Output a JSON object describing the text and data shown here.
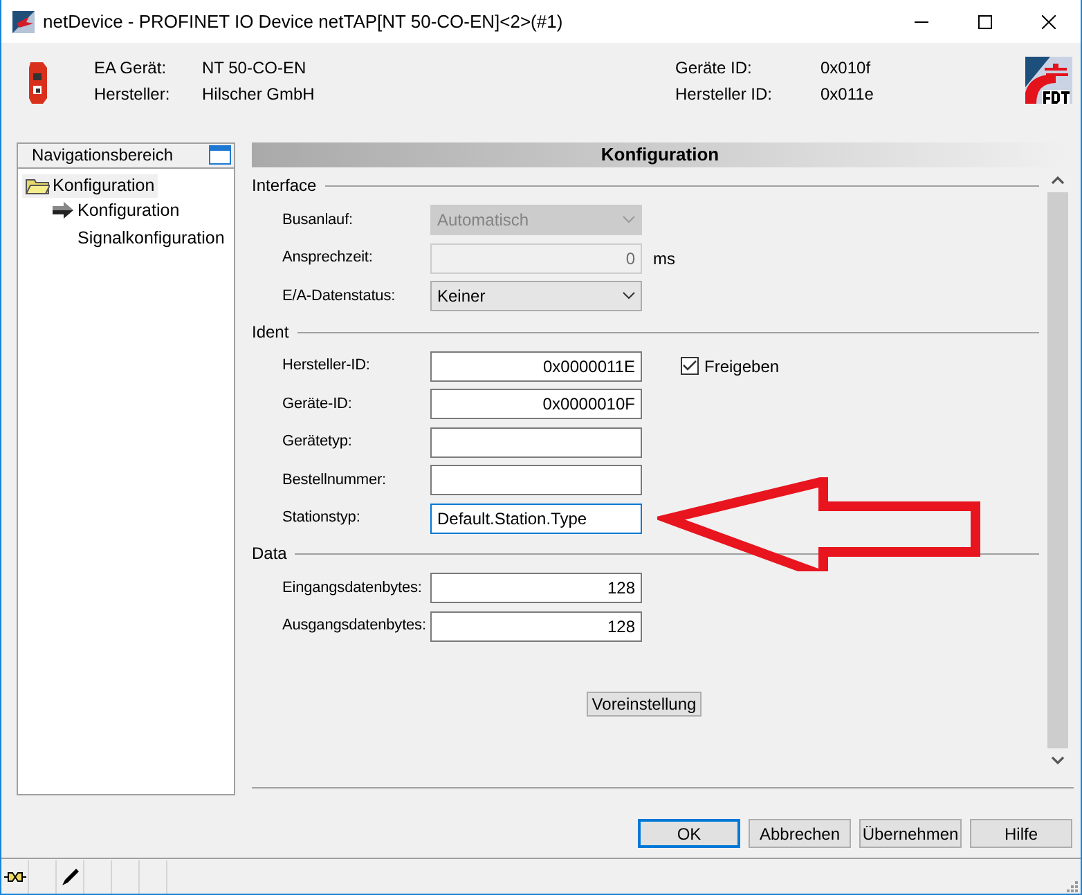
{
  "window": {
    "title": "netDevice - PROFINET IO Device netTAP[NT 50-CO-EN]<2>(#1)"
  },
  "header": {
    "left": [
      {
        "label": "EA Gerät:",
        "value": "NT 50-CO-EN"
      },
      {
        "label": "Hersteller:",
        "value": "Hilscher GmbH"
      }
    ],
    "right": [
      {
        "label": "Geräte ID:",
        "value": "0x010f"
      },
      {
        "label": "Hersteller ID:",
        "value": "0x011e"
      }
    ]
  },
  "navigation": {
    "title": "Navigationsbereich",
    "items": [
      {
        "label": "Konfiguration",
        "selected": true,
        "children": [
          {
            "label": "Konfiguration",
            "selected": false,
            "current": true
          },
          {
            "label": "Signalkonfiguration",
            "selected": false,
            "current": false
          }
        ]
      }
    ]
  },
  "panel": {
    "title": "Konfiguration",
    "sections": [
      {
        "title": "Interface",
        "rows": [
          {
            "label": "Busanlauf:",
            "kind": "select",
            "value": "Automatisch",
            "disabled": true
          },
          {
            "label": "Ansprechzeit:",
            "kind": "input",
            "value": "0",
            "disabled": true,
            "unit": "ms"
          },
          {
            "label": "E/A-Datenstatus:",
            "kind": "select",
            "value": "Keiner",
            "disabled": false
          }
        ]
      },
      {
        "title": "Ident",
        "rows": [
          {
            "label": "Hersteller-ID:",
            "kind": "input",
            "value": "0x0000011E",
            "disabled": false,
            "checkbox": {
              "label": "Freigeben",
              "checked": true
            }
          },
          {
            "label": "Geräte-ID:",
            "kind": "input",
            "value": "0x0000010F",
            "disabled": false
          },
          {
            "label": "Gerätetyp:",
            "kind": "input",
            "disabled": false
          },
          {
            "label": "Bestellnummer:",
            "kind": "input",
            "disabled": false
          },
          {
            "label": "Stationstyp:",
            "kind": "input",
            "value": "Default.Station.Type",
            "disabled": false,
            "focused": true
          }
        ]
      },
      {
        "title": "Data",
        "rows": [
          {
            "label": "Eingangsdatenbytes:",
            "kind": "input",
            "value": "128",
            "disabled": false
          },
          {
            "label": "Ausgangsdatenbytes:",
            "kind": "input",
            "value": "128",
            "disabled": false
          }
        ]
      }
    ],
    "reset_button": "Voreinstellung"
  },
  "buttons": [
    {
      "label": "OK",
      "default": true
    },
    {
      "label": "Abbrechen",
      "default": false
    },
    {
      "label": "Übernehmen",
      "default": false
    },
    {
      "label": "Hilfe",
      "default": false
    }
  ]
}
